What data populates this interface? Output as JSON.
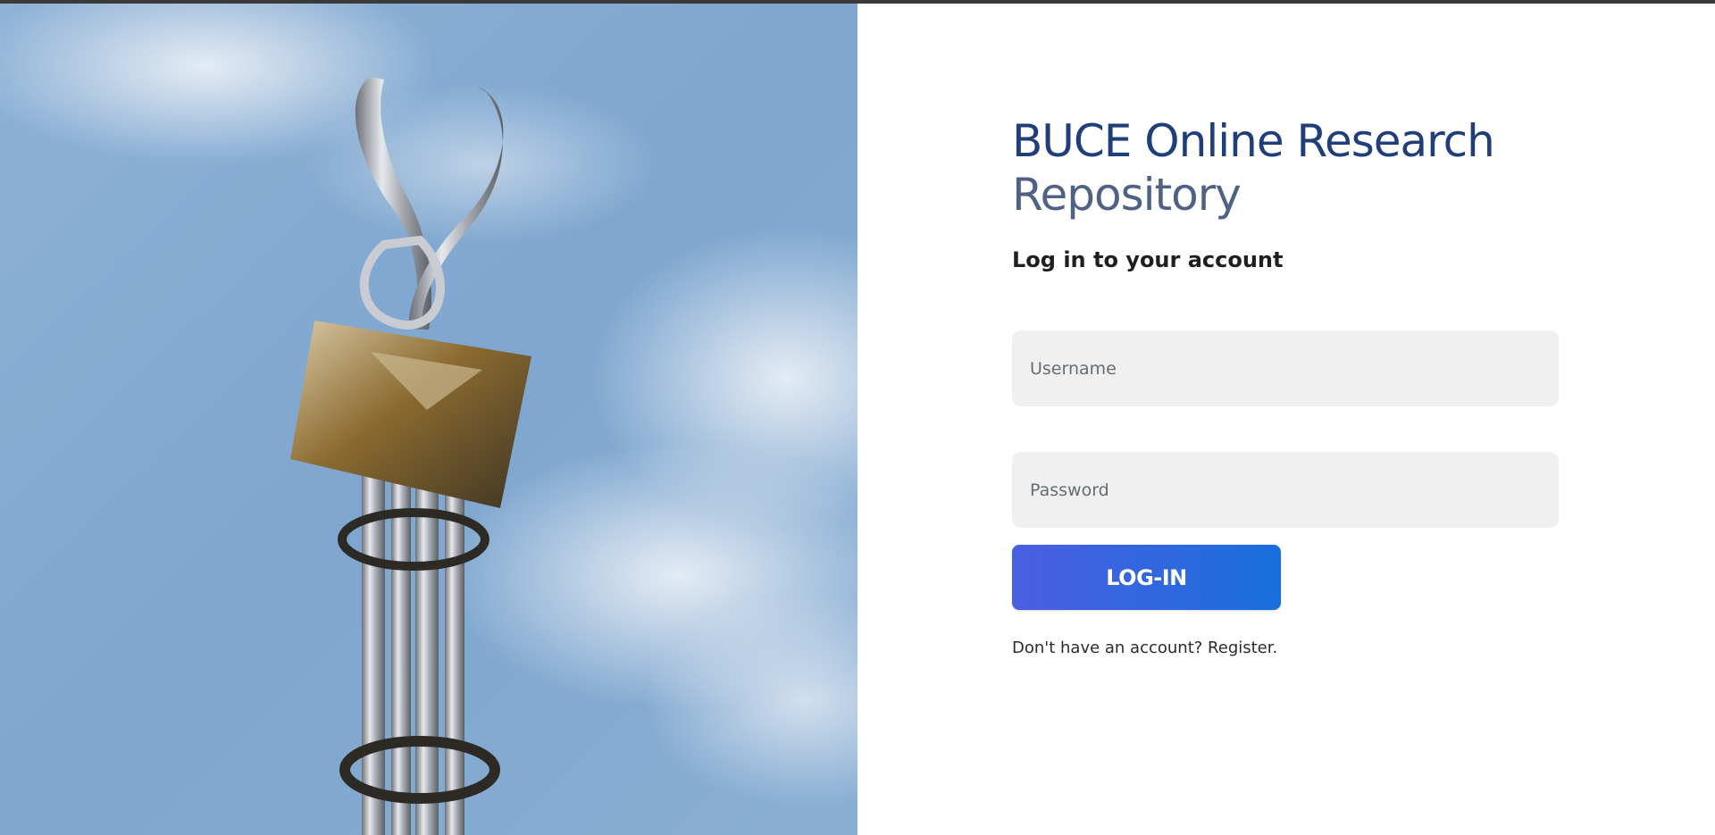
{
  "hero": {
    "image": "sky-with-metal-sculpture-monument"
  },
  "login": {
    "title_line1": "BUCE Online Research",
    "title_line2": "Repository",
    "subtitle": "Log in to your account",
    "username_placeholder": "Username",
    "username_value": "",
    "password_placeholder": "Password",
    "password_value": "",
    "button_label": "LOG-IN",
    "register_prompt": "Don't have an account? ",
    "register_link": "Register."
  },
  "colors": {
    "title_primary": "#203f7a",
    "title_secondary": "#4f6286",
    "button_gradient_start": "#4a5ee0",
    "button_gradient_end": "#1a6fdd",
    "field_background": "#f0f0f0"
  }
}
